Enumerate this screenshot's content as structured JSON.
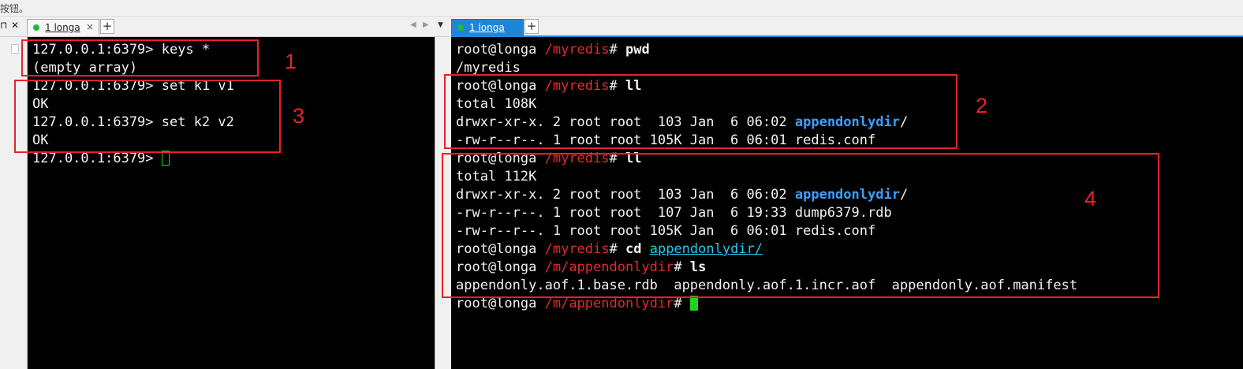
{
  "top_hint": "按钮。",
  "left_tabbar": {
    "tab_label": "1 longa",
    "close_glyph": "×",
    "add_glyph": "+"
  },
  "right_tabbar": {
    "tab_label": "1 longa",
    "add_glyph": "+"
  },
  "left_terminal": {
    "lines": [
      "127.0.0.1:6379> keys *",
      "(empty array)",
      "127.0.0.1:6379> set k1 v1",
      "OK",
      "127.0.0.1:6379> set k2 v2",
      "OK",
      "127.0.0.1:6379> "
    ]
  },
  "right_terminal": {
    "prompt_user": "root@longa",
    "dir_myredis": "/myredis",
    "dir_append": "/m/appendonlydir",
    "l0_cmd": "pwd",
    "l1": "/myredis",
    "l2_cmd": "ll",
    "l3": "total 108K",
    "l4_pre": "drwxr-xr-x. 2 root root  103 Jan  6 06:02 ",
    "l4_dir": "appendonlydir",
    "l4_post": "/",
    "l5": "-rw-r--r--. 1 root root 105K Jan  6 06:01 redis.conf",
    "l6_cmd": "ll",
    "l7": "total 112K",
    "l8_pre": "drwxr-xr-x. 2 root root  103 Jan  6 06:02 ",
    "l8_dir": "appendonlydir",
    "l8_post": "/",
    "l9": "-rw-r--r--. 1 root root  107 Jan  6 19:33 dump6379.rdb",
    "l10": "-rw-r--r--. 1 root root 105K Jan  6 06:01 redis.conf",
    "l11_cmd": "cd",
    "l11_arg": "appendonlydir/",
    "l12_cmd": "ls",
    "l13": "appendonly.aof.1.base.rdb  appendonly.aof.1.incr.aof  appendonly.aof.manifest"
  },
  "annotations": {
    "n1": "1",
    "n2": "2",
    "n3": "3",
    "n4": "4"
  },
  "colors": {
    "annotation_red": "#e8212b",
    "tab_active_blue": "#1d86d8",
    "cursor_green": "#1fd321",
    "path_red": "#e02b2b"
  }
}
